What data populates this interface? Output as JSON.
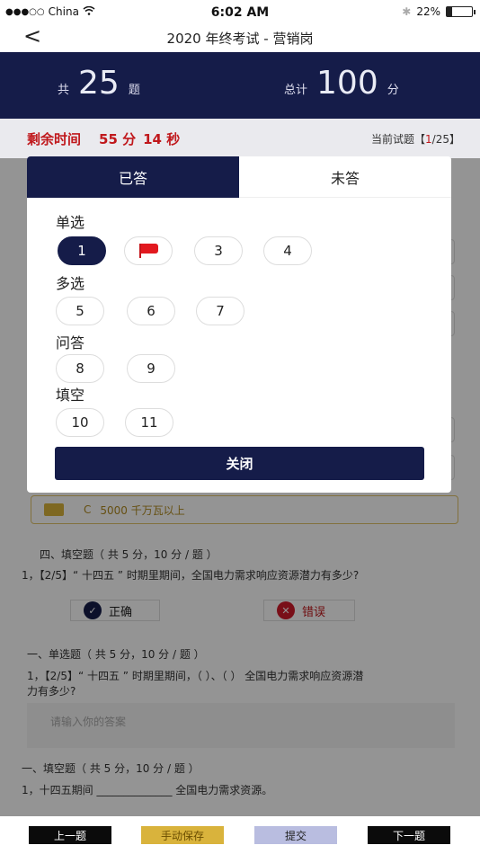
{
  "status_bar": {
    "carrier": "China",
    "time": "6:02 AM",
    "battery_text": "22%",
    "battery_level": 0.22
  },
  "nav": {
    "title": "2020 年终考试 - 营销岗"
  },
  "summary": {
    "total_prefix": "共",
    "total_count": "25",
    "total_suffix": "题",
    "score_prefix": "总计",
    "score_value": "100",
    "score_suffix": "分"
  },
  "timer": {
    "label": "剩余时间",
    "minutes": "55 分",
    "seconds": "14 秒",
    "current_label": "当前试题【",
    "current_index": "1",
    "current_total": "/25】"
  },
  "modal": {
    "tabs": [
      {
        "label": "已答",
        "active": true
      },
      {
        "label": "未答",
        "active": false
      }
    ],
    "sections": [
      {
        "title": "单选",
        "items": [
          "1",
          "flag",
          "3",
          "4"
        ]
      },
      {
        "title": "多选",
        "items": [
          "5",
          "6",
          "7"
        ]
      },
      {
        "title": "问答",
        "items": [
          "8",
          "9"
        ]
      },
      {
        "title": "填空",
        "items": [
          "10",
          "11"
        ]
      }
    ],
    "close_label": "关闭"
  },
  "background": {
    "option_c": "C",
    "option_c_text": "5000 千万瓦以上",
    "section4_title": "四、填空题（ 共 5 分，10 分 / 题 ）",
    "q_fill": "1，【2/5】“ 十四五 ” 时期里期间，全国电力需求响应资源潜力有多少?",
    "correct_label": "正确",
    "wrong_label": "错误",
    "section1_title": "一、单选题（ 共 5 分，10 分 / 题 ）",
    "q_single_line1": "1，【2/5】“ 十四五 ” 时期里期间，（ ）、（ ） 全国电力需求响应资源潜",
    "q_single_line2": "力有多少?",
    "answer_placeholder": "请输入你的答案",
    "section1b_title": "一、填空题（  共 5 分，10 分 / 题 ）",
    "q_blank": "1，十四五期间 ______________ 全国电力需求资源。"
  },
  "bottom": {
    "prev": "上一题",
    "save": "手动保存",
    "submit": "提交",
    "next": "下一题"
  },
  "colors": {
    "navy": "#151c49",
    "red": "#c0181c",
    "gold": "#d9b33c",
    "lavender": "#b9bde0"
  }
}
